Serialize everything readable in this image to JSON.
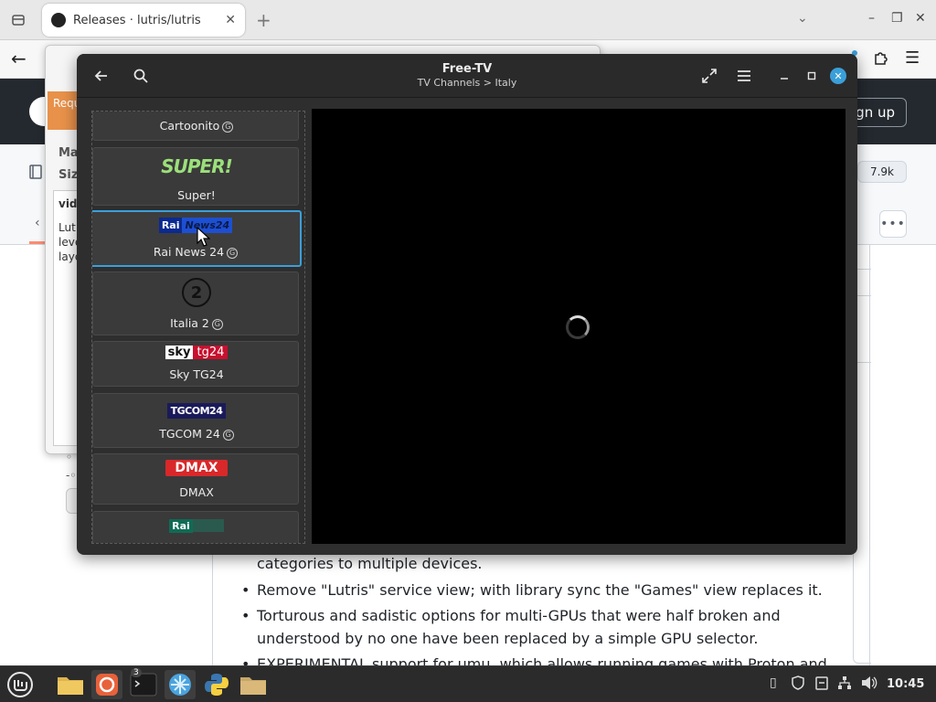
{
  "browser": {
    "tab_title": "Releases · lutris/lutris",
    "tab_close": "✕",
    "new_tab": "+",
    "window_controls": [
      "–",
      "❐",
      "✕"
    ]
  },
  "github": {
    "request_tag": "Requ",
    "sign_up": "ign up",
    "star_count": "7.9k",
    "more": "•••",
    "release_text_fragment": "categories to multiple devices.",
    "release_items": [
      "Remove \"Lutris\" service view; with library sync the \"Games\" view replaces it.",
      "Torturous and sadistic options for multi-GPUs that were half broken and understood by no one have been replaced by a simple GPU selector.",
      "EXPERIMENTAL support for umu, which allows running games with Proton and Vessel"
    ]
  },
  "lutris_dialog": {
    "info_lines": [
      "Ma",
      "Siz"
    ],
    "panel_lines": [
      "vid",
      "Lut",
      "leve",
      "laye"
    ]
  },
  "freetv": {
    "title": "Free-TV",
    "subtitle": "TV Channels > Italy",
    "channels": [
      {
        "name": "Cartoonito",
        "geo": true
      },
      {
        "name": "Super!",
        "geo": false,
        "logo_text": "SUPER!"
      },
      {
        "name": "Rai News 24",
        "geo": true,
        "logo_text": "News24",
        "logo_prefix": "Rai"
      },
      {
        "name": "Italia 2",
        "geo": true,
        "logo_text": "2"
      },
      {
        "name": "Sky TG24",
        "geo": false,
        "logo_prefix": "sky",
        "logo_text": "tg24"
      },
      {
        "name": "TGCOM 24",
        "geo": true,
        "logo_text": "TGCOM24"
      },
      {
        "name": "DMAX",
        "geo": false,
        "logo_text": "DMAX"
      },
      {
        "name": "",
        "geo": false,
        "logo_prefix": "Rai"
      }
    ],
    "geo_mark": "G",
    "accent": "#3a9fd9"
  },
  "taskbar": {
    "terminal_badge": "3",
    "clock": "10:45"
  }
}
